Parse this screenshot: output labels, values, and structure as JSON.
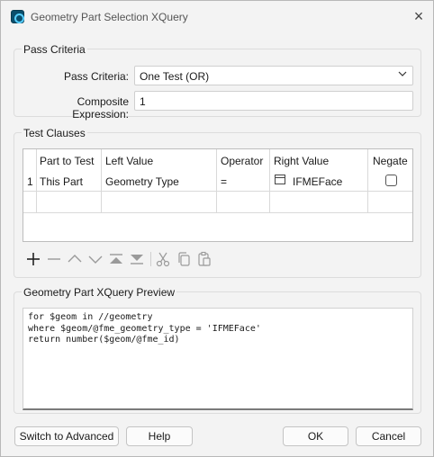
{
  "window": {
    "title": "Geometry Part Selection XQuery"
  },
  "pass_criteria_group": {
    "title": "Pass Criteria",
    "pass_criteria_label": "Pass Criteria:",
    "pass_criteria_value": "One Test (OR)",
    "composite_label": "Composite Expression:",
    "composite_value": "1"
  },
  "test_clauses_group": {
    "title": "Test Clauses",
    "columns": [
      "Part to Test",
      "Left Value",
      "Operator",
      "Right Value",
      "Negate"
    ],
    "rows": [
      {
        "num": "1",
        "part": "This Part",
        "left": "Geometry Type",
        "op": "=",
        "right": "IFMEFace",
        "negate": false
      }
    ]
  },
  "toolbar": {
    "icons": [
      "add-icon",
      "remove-icon",
      "move-up-icon",
      "move-down-icon",
      "move-top-icon",
      "move-bottom-icon",
      "cut-icon",
      "copy-icon",
      "paste-icon"
    ]
  },
  "preview_group": {
    "title": "Geometry Part XQuery Preview",
    "code": "for $geom in //geometry\nwhere $geom/@fme_geometry_type = 'IFMEFace'\nreturn number($geom/@fme_id)"
  },
  "buttons": {
    "advanced": "Switch to Advanced",
    "help": "Help",
    "ok": "OK",
    "cancel": "Cancel"
  }
}
